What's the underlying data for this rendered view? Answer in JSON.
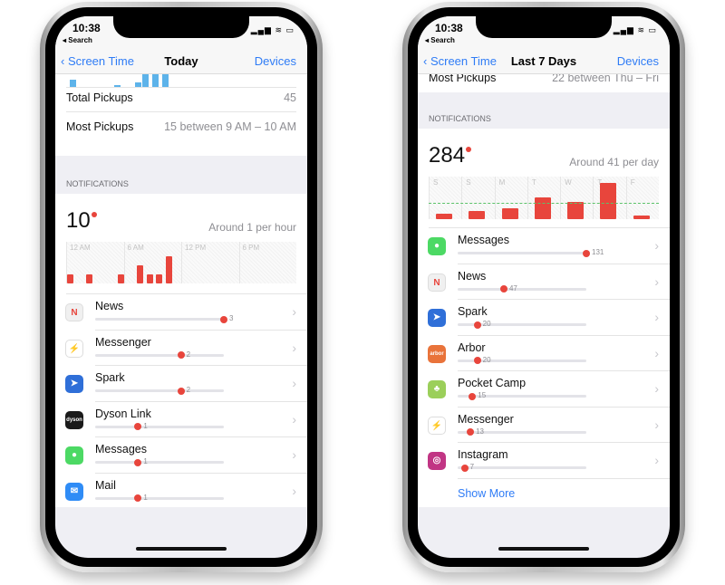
{
  "left": {
    "status": {
      "time": "10:38",
      "back": "◂ Search"
    },
    "nav": {
      "back": "Screen Time",
      "title": "Today",
      "right": "Devices"
    },
    "pickups": [
      {
        "label": "Total Pickups",
        "value": "45"
      },
      {
        "label": "Most Pickups",
        "value": "15 between 9 AM – 10 AM"
      }
    ],
    "notifications": {
      "header": "NOTIFICATIONS",
      "total": "10",
      "average": "Around 1 per hour"
    },
    "chart_labels": [
      "12 AM",
      "6 AM",
      "12 PM",
      "6 PM"
    ],
    "apps": [
      {
        "name": "News",
        "count": 3,
        "icon": "news-icon",
        "color": "#f0f0f0"
      },
      {
        "name": "Messenger",
        "count": 2,
        "icon": "messenger-icon",
        "color": "#ffffff"
      },
      {
        "name": "Spark",
        "count": 2,
        "icon": "spark-icon",
        "color": "#2f6fd8"
      },
      {
        "name": "Dyson Link",
        "count": 1,
        "icon": "dyson-icon",
        "color": "#1a1a1a"
      },
      {
        "name": "Messages",
        "count": 1,
        "icon": "messages-icon",
        "color": "#4cd964"
      },
      {
        "name": "Mail",
        "count": 1,
        "icon": "mail-icon",
        "color": "#2f8cf6"
      }
    ],
    "chart_data": {
      "type": "bar",
      "x": "hour",
      "categories": [
        0,
        2,
        5,
        7,
        8,
        9,
        10
      ],
      "values": [
        1,
        1,
        1,
        2,
        1,
        1,
        3
      ],
      "xlim": [
        0,
        24
      ],
      "tick_labels": [
        "12 AM",
        "6 AM",
        "12 PM",
        "6 PM"
      ]
    }
  },
  "right": {
    "status": {
      "time": "10:38",
      "back": "◂ Search"
    },
    "nav": {
      "back": "Screen Time",
      "title": "Last 7 Days",
      "right": "Devices"
    },
    "pickups": [
      {
        "label": "Most Pickups",
        "value": "22 between Thu – Fri"
      }
    ],
    "notifications": {
      "header": "NOTIFICATIONS",
      "total": "284",
      "average": "Around 41 per day"
    },
    "apps": [
      {
        "name": "Messages",
        "count": 131,
        "icon": "messages-icon",
        "color": "#4cd964"
      },
      {
        "name": "News",
        "count": 47,
        "icon": "news-icon",
        "color": "#f0f0f0"
      },
      {
        "name": "Spark",
        "count": 20,
        "icon": "spark-icon",
        "color": "#2f6fd8"
      },
      {
        "name": "Arbor",
        "count": 20,
        "icon": "arbor-icon",
        "color": "#e9733a"
      },
      {
        "name": "Pocket Camp",
        "count": 15,
        "icon": "pocket-camp-icon",
        "color": "#9bcf5a"
      },
      {
        "name": "Messenger",
        "count": 13,
        "icon": "messenger-icon",
        "color": "#ffffff"
      },
      {
        "name": "Instagram",
        "count": 7,
        "icon": "instagram-icon",
        "color": "#c13584"
      }
    ],
    "show_more": "Show More",
    "chart_data": {
      "type": "bar",
      "categories": [
        "S",
        "S",
        "M",
        "T",
        "W",
        "T",
        "F"
      ],
      "values": [
        15,
        23,
        29,
        60,
        48,
        99,
        10
      ],
      "average": 41,
      "ylim": [
        0,
        110
      ]
    }
  },
  "icon_glyphs": {
    "news-icon": "N",
    "messenger-icon": "⚡",
    "spark-icon": "➤",
    "dyson-icon": "dyson",
    "messages-icon": "●",
    "mail-icon": "✉",
    "arbor-icon": "arbor",
    "pocket-camp-icon": "♣",
    "instagram-icon": "◎"
  }
}
